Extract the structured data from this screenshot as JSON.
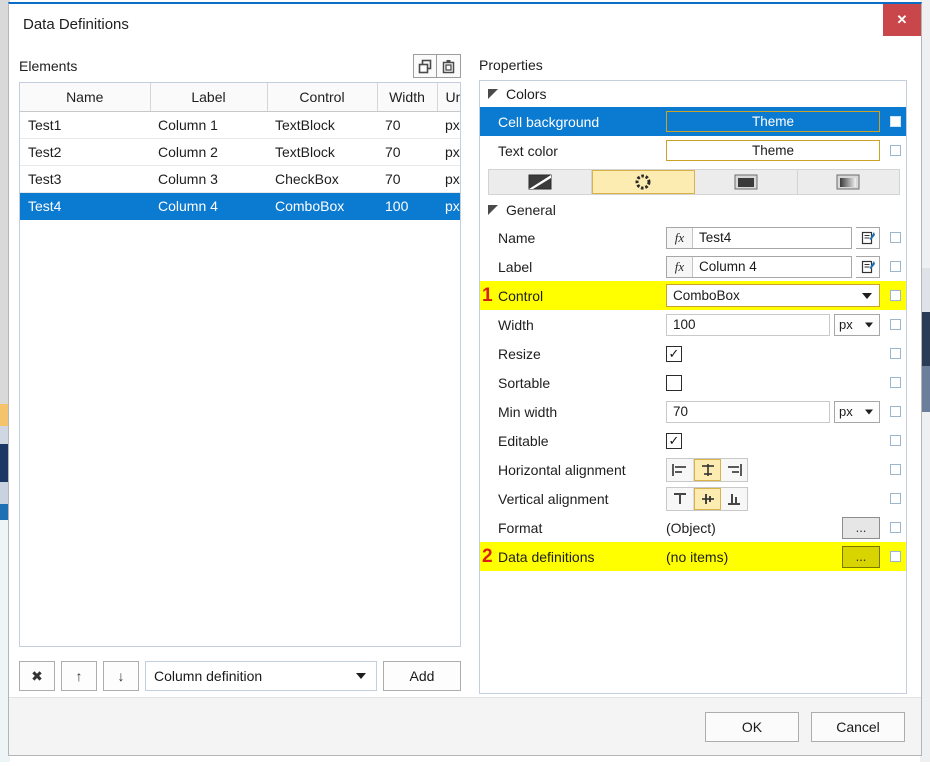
{
  "window": {
    "title": "Data Definitions",
    "close_label": "✕"
  },
  "left_pane": {
    "heading": "Elements",
    "tools": [
      {
        "name": "copy-icon",
        "tooltip": "Copy"
      },
      {
        "name": "paste-icon",
        "tooltip": "Paste"
      }
    ],
    "table": {
      "columns": [
        "Name",
        "Label",
        "Control",
        "Width",
        "Unit"
      ],
      "rows": [
        {
          "name": "Test1",
          "label": "Column 1",
          "control": "TextBlock",
          "width": "70",
          "unit": "px",
          "selected": false
        },
        {
          "name": "Test2",
          "label": "Column 2",
          "control": "TextBlock",
          "width": "70",
          "unit": "px",
          "selected": false
        },
        {
          "name": "Test3",
          "label": "Column 3",
          "control": "CheckBox",
          "width": "70",
          "unit": "px",
          "selected": false
        },
        {
          "name": "Test4",
          "label": "Column 4",
          "control": "ComboBox",
          "width": "100",
          "unit": "px",
          "selected": true
        }
      ]
    },
    "toolbar": {
      "delete_label": "✖",
      "move_up_label": "↑",
      "move_down_label": "↓",
      "add_type_value": "Column definition",
      "add_label": "Add"
    }
  },
  "right_pane": {
    "heading": "Properties",
    "groups": [
      {
        "name": "Colors",
        "rows": [
          {
            "label": "Cell background",
            "value": "Theme",
            "kind": "theme",
            "selected": true
          },
          {
            "label": "Text color",
            "value": "Theme",
            "kind": "theme",
            "selected": false
          }
        ],
        "color_modes": [
          {
            "name": "no-color-icon",
            "active": false
          },
          {
            "name": "theme-color-icon",
            "active": true
          },
          {
            "name": "solid-color-icon",
            "active": false
          },
          {
            "name": "gradient-color-icon",
            "active": false
          }
        ]
      },
      {
        "name": "General",
        "rows": [
          {
            "label": "Name",
            "value": "Test4",
            "kind": "fx"
          },
          {
            "label": "Label",
            "value": "Column 4",
            "kind": "fx"
          },
          {
            "label": "Control",
            "value": "ComboBox",
            "kind": "combo",
            "highlight": true,
            "annotation": "1"
          },
          {
            "label": "Width",
            "value": "100",
            "unit": "px",
            "kind": "number"
          },
          {
            "label": "Resize",
            "value": true,
            "kind": "checkbox"
          },
          {
            "label": "Sortable",
            "value": false,
            "kind": "checkbox"
          },
          {
            "label": "Min width",
            "value": "70",
            "unit": "px",
            "kind": "number"
          },
          {
            "label": "Editable",
            "value": true,
            "kind": "checkbox"
          },
          {
            "label": "Horizontal alignment",
            "kind": "halign",
            "active_index": 1
          },
          {
            "label": "Vertical alignment",
            "kind": "valign",
            "active_index": 1
          },
          {
            "label": "Format",
            "value": "(Object)",
            "kind": "ellipsis"
          },
          {
            "label": "Data definitions",
            "value": "(no items)",
            "kind": "ellipsis",
            "highlight": true,
            "annotation": "2"
          }
        ]
      }
    ]
  },
  "footer": {
    "ok_label": "OK",
    "cancel_label": "Cancel"
  },
  "colors": {
    "selection_blue": "#0b7ad1",
    "highlight_yellow": "#ffff00",
    "annotation_red": "#d91f11",
    "field_gold": "#c9a227",
    "close_red": "#c9474a",
    "title_accent": "#0a6cc4"
  }
}
